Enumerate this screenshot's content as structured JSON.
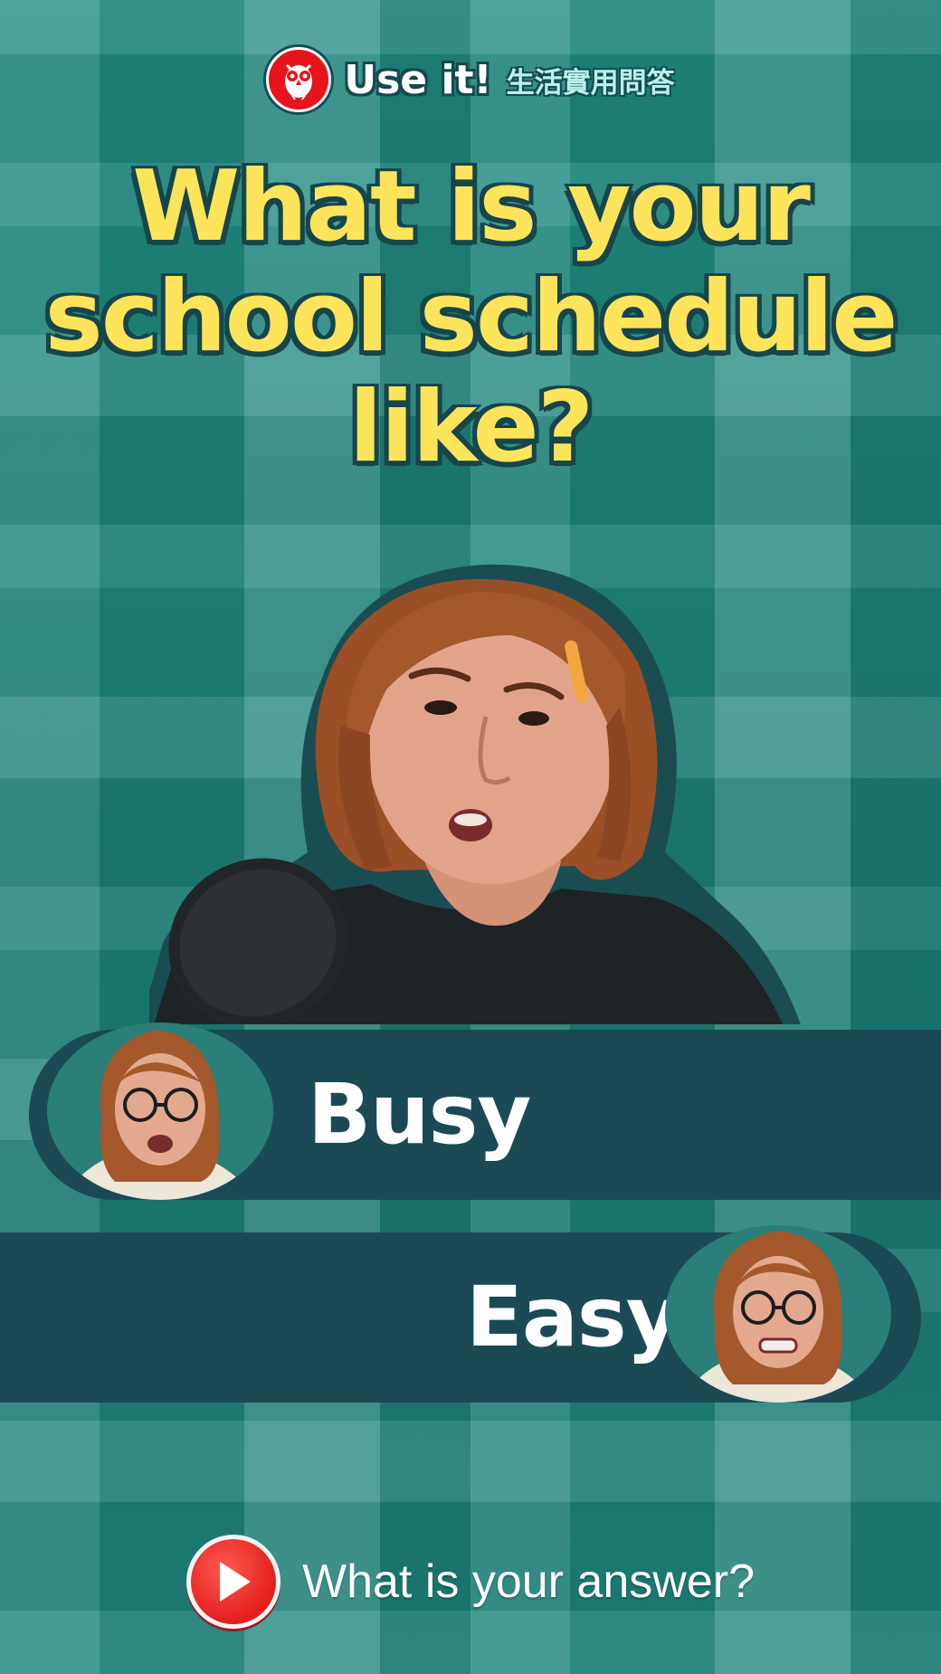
{
  "brand": {
    "title": "Use it!",
    "subtitle": "生活實用問答",
    "logo_icon": "owl-icon",
    "logo_color": "#e8141c"
  },
  "headline": {
    "line1": "What is your",
    "line2": "school schedule",
    "line3": "like?",
    "color": "#fde45a"
  },
  "answers": [
    {
      "label": "Busy",
      "avatar_icon": "host-avatar-talking"
    },
    {
      "label": "Easy",
      "avatar_icon": "host-avatar-grimacing"
    }
  ],
  "prompt": {
    "text": "What is your answer?",
    "icon": "play-icon"
  },
  "colors": {
    "background": "#1f8a80",
    "answer_bar": "#1b4a55",
    "headline_outline": "#16454a"
  }
}
